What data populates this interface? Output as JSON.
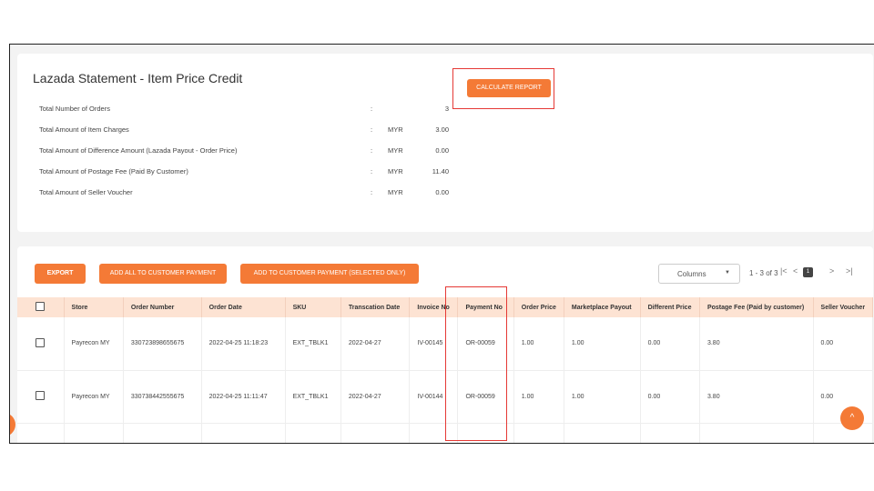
{
  "report": {
    "title": "Lazada Statement - Item Price Credit",
    "calculate_label": "CALCULATE REPORT",
    "summary": [
      {
        "label": "Total Number of Orders",
        "colon": ":",
        "currency": "",
        "value": "3"
      },
      {
        "label": "Total Amount of Item Charges",
        "colon": ":",
        "currency": "MYR",
        "value": "3.00"
      },
      {
        "label": "Total Amount of Difference Amount (Lazada Payout - Order Price)",
        "colon": ":",
        "currency": "MYR",
        "value": "0.00"
      },
      {
        "label": "Total Amount of Postage Fee (Paid By Customer)",
        "colon": ":",
        "currency": "MYR",
        "value": "11.40"
      },
      {
        "label": "Total Amount of Seller Voucher",
        "colon": ":",
        "currency": "MYR",
        "value": "0.00"
      }
    ]
  },
  "toolbar": {
    "export_label": "EXPORT",
    "add_all_label": "ADD ALL TO CUSTOMER PAYMENT",
    "add_selected_label": "ADD TO CUSTOMER PAYMENT (SELECTED ONLY)",
    "columns_label": "Columns",
    "pagination_text": "1 - 3 of 3",
    "current_page": "1",
    "first_icon": "|<",
    "prev_icon": "<",
    "next_icon": ">",
    "last_icon": ">|"
  },
  "table": {
    "columns": [
      "Store",
      "Order Number",
      "Order Date",
      "SKU",
      "Transcation Date",
      "Invoice No",
      "Payment No",
      "Order Price",
      "Marketplace Payout",
      "Different Price",
      "Postage Fee (Paid by customer)",
      "Seller Voucher"
    ],
    "rows": [
      [
        "Payrecon MY",
        "330723898655675",
        "2022-04-25 11:18:23",
        "EXT_TBLK1",
        "2022-04-27",
        "IV-00145",
        "OR-00059",
        "1.00",
        "1.00",
        "0.00",
        "3.80",
        "0.00"
      ],
      [
        "Payrecon MY",
        "330738442555675",
        "2022-04-25 11:11:47",
        "EXT_TBLK1",
        "2022-04-27",
        "IV-00144",
        "OR-00059",
        "1.00",
        "1.00",
        "0.00",
        "3.80",
        "0.00"
      ]
    ]
  },
  "icons": {
    "scroll_top": "chevron-up-icon",
    "side_tab": "side-handle-icon"
  },
  "colors": {
    "accent": "#f47a36",
    "highlight": "#e53935",
    "header_bg": "#fde3d3"
  }
}
